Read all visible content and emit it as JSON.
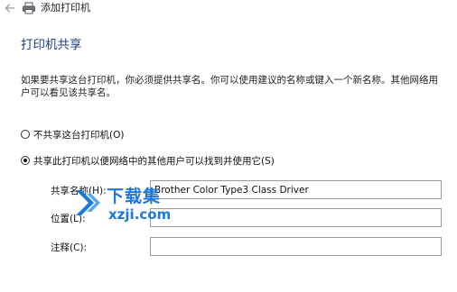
{
  "window": {
    "title": "添加打印机"
  },
  "page": {
    "heading": "打印机共享",
    "description": "如果要共享这台打印机，你必须提供共享名。你可以使用建议的名称或键入一个新名称。其他网络用户可以看见该共享名。"
  },
  "options": [
    {
      "label": "不共享这台打印机(O)",
      "checked": false
    },
    {
      "label": "共享此打印机以便网络中的其他用户可以找到并使用它(S)",
      "checked": true
    }
  ],
  "fields": {
    "share_name": {
      "label": "共享名称(H):",
      "value": "Brother Color Type3 Class Driver"
    },
    "location": {
      "label": "位置(L):",
      "value": ""
    },
    "comment": {
      "label": "注释(C):",
      "value": ""
    }
  },
  "watermark": {
    "text_cn": "下载集",
    "text_en": "xzji.com",
    "color": "#1e78d8"
  }
}
